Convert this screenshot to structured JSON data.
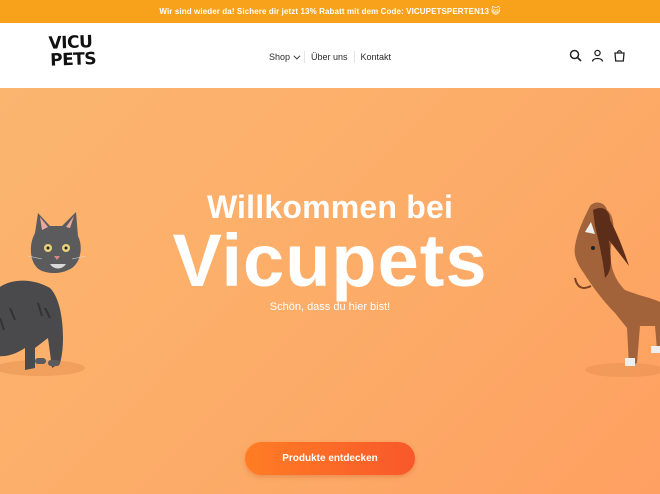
{
  "announcement": {
    "text": "Wir sind wieder da! Sichere dir jetzt 13% Rabatt mit dem Code: VICUPETSPERTEN13",
    "emoji": "😺"
  },
  "header": {
    "logo_line1": "VICU",
    "logo_line2": "PETS",
    "nav": {
      "shop": "Shop",
      "about": "Über uns",
      "contact": "Kontakt"
    },
    "icons": [
      "search-icon",
      "account-icon",
      "cart-icon"
    ]
  },
  "hero": {
    "title_line1": "Willkommen bei",
    "title_line2": "Vicupets",
    "subtitle": "Schön, dass du hier bist!",
    "cta_label": "Produkte entdecken"
  },
  "colors": {
    "announcement_bg": "#f8a11a",
    "hero_bg": "#fcae69",
    "cta_bg": "#f86a27"
  }
}
